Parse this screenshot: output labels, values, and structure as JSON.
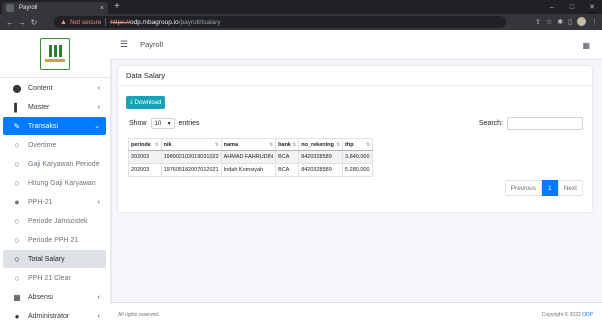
{
  "browser": {
    "tab_title": "Payroll",
    "tab_close": "×",
    "new_tab": "+",
    "win_min": "–",
    "win_max": "□",
    "win_close": "✕",
    "back": "←",
    "forward": "→",
    "reload": "↻",
    "security_label": "Not secure",
    "url_scheme": "https://",
    "url_host": "odp.mbagroup.io",
    "url_path": "/payroll/tsalary"
  },
  "sidebar": {
    "items": [
      {
        "label": "Content",
        "icon": "circle-icon",
        "glyph": "⬤",
        "arrow": "‹"
      },
      {
        "label": "Master",
        "icon": "file-icon",
        "glyph": "▌",
        "arrow": "‹"
      },
      {
        "label": "Transaksi",
        "icon": "edit-icon",
        "glyph": "✎",
        "arrow": "⌄"
      },
      {
        "label": "Overtime",
        "glyph": "○"
      },
      {
        "label": "Gaji Karyawan Periode",
        "glyph": "○"
      },
      {
        "label": "Hitung Gaji Karyawan",
        "glyph": "○"
      },
      {
        "label": "PPH-21",
        "glyph": "●",
        "arrow": "‹"
      },
      {
        "label": "Periode Jamsostek",
        "glyph": "○"
      },
      {
        "label": "Periode PPH 21",
        "glyph": "○"
      },
      {
        "label": "Total Salary",
        "glyph": "○"
      },
      {
        "label": "PPH 21 Clear",
        "glyph": "○"
      },
      {
        "label": "Absensi",
        "icon": "table-icon",
        "glyph": "▦",
        "arrow": "‹"
      },
      {
        "label": "Administrator",
        "icon": "user-icon",
        "glyph": "●",
        "arrow": "‹"
      }
    ]
  },
  "topnav": {
    "title": "Payroll",
    "menu_glyph": "☰",
    "grid_glyph": "▦"
  },
  "card": {
    "title": "Data Salary",
    "download_label": "Download",
    "download_glyph": "⤓",
    "show_label": "Show",
    "entries_value": "10",
    "entries_label": "entries",
    "search_label": "Search:"
  },
  "table": {
    "columns": [
      "periode",
      "nik",
      "nama",
      "bank",
      "no_rekening",
      "thp"
    ],
    "rows": [
      [
        "202003",
        "198902102019031022",
        "AHMAD FAHRUDIN",
        "BCA",
        "8420328589",
        "3.840.000"
      ],
      [
        "202003",
        "197605182007012021",
        "Indah Komsiyah",
        "BCA",
        "8420328589",
        "5.280.000"
      ]
    ]
  },
  "pager": {
    "previous": "Previous",
    "current": "1",
    "next": "Next"
  },
  "footer": {
    "left": "All rights reserved.",
    "right_prefix": "Copyright © 2022",
    "right_brand": "ODP"
  }
}
